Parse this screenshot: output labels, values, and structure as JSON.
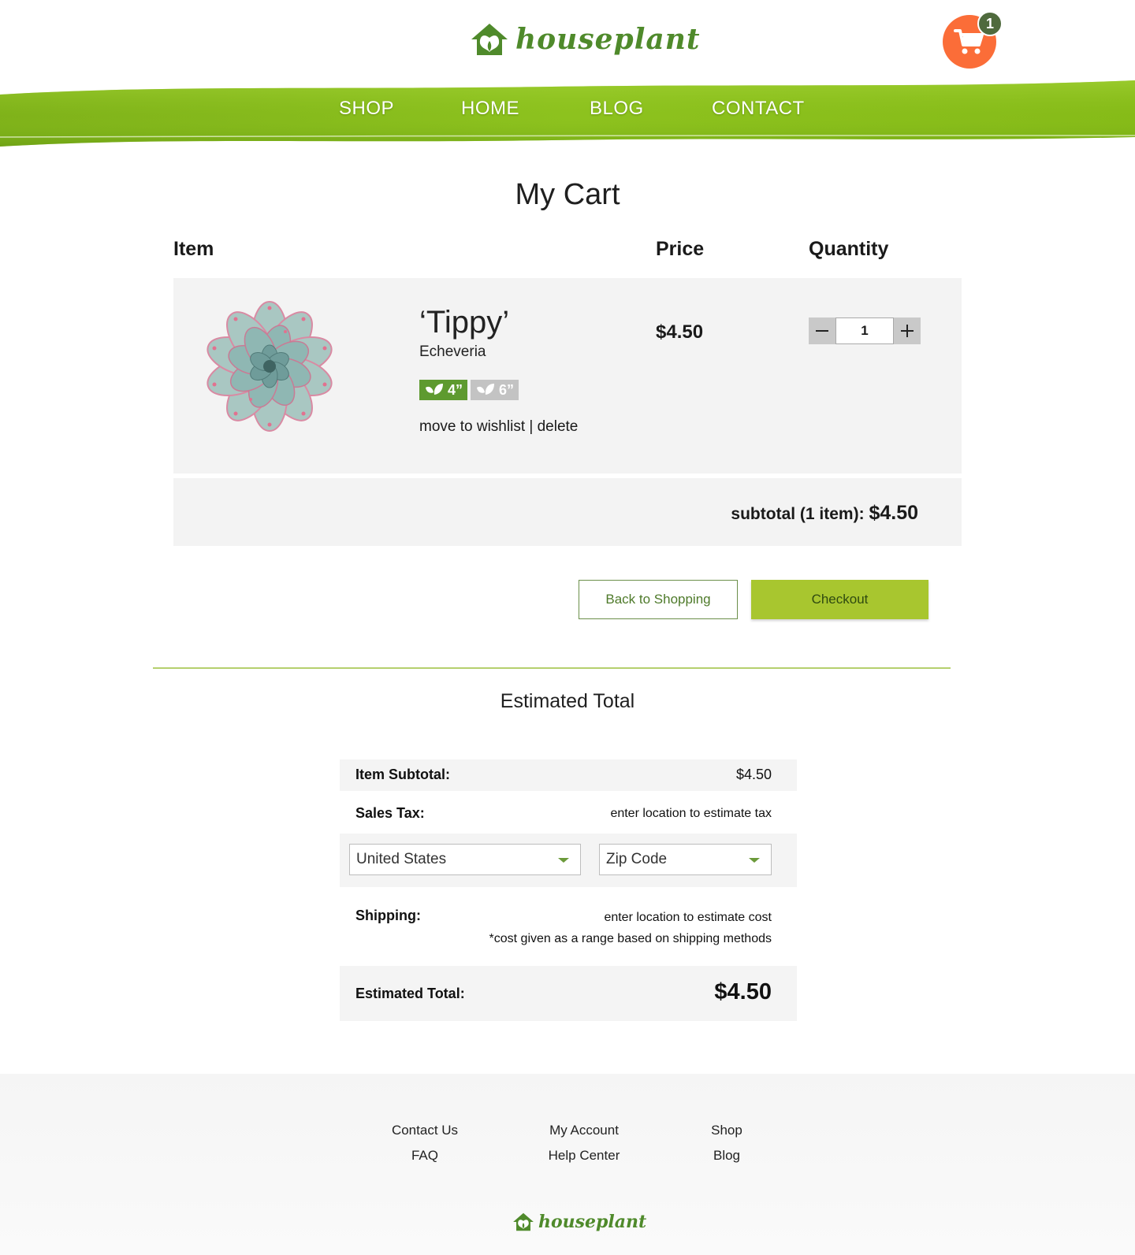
{
  "brand": {
    "name": "houseplant",
    "primary_color": "#4f8a2b",
    "accent_color": "#fb6d38",
    "nav_green": "#8fc31f"
  },
  "cart_icon": {
    "icon": "shopping-cart-icon",
    "count": "1"
  },
  "nav": {
    "items": [
      "SHOP",
      "HOME",
      "BLOG",
      "CONTACT"
    ]
  },
  "cart": {
    "title": "My Cart",
    "columns": {
      "item": "Item",
      "price": "Price",
      "quantity": "Quantity"
    },
    "items": [
      {
        "name": "‘Tippy’",
        "type": "Echeveria",
        "image": "succulent-echeveria",
        "sizes": [
          {
            "label": "4”",
            "selected": true
          },
          {
            "label": "6”",
            "selected": false
          }
        ],
        "actions": {
          "wishlist": "move to wishlist",
          "separator": "|",
          "delete": "delete"
        },
        "price": "$4.50",
        "quantity": "1"
      }
    ],
    "subtotal_label": "subtotal (1 item):",
    "subtotal_value": "$4.50",
    "back_button": "Back to Shopping",
    "checkout_button": "Checkout"
  },
  "estimate": {
    "title": "Estimated Total",
    "item_subtotal_label": "Item Subtotal:",
    "item_subtotal_value": "$4.50",
    "sales_tax_label": "Sales Tax:",
    "sales_tax_note": "enter location to estimate tax",
    "country_select": "United States",
    "zip_select": "Zip Code",
    "shipping_label": "Shipping:",
    "shipping_note": "enter location to estimate cost",
    "shipping_subnote": "*cost given as a range based on shipping methods",
    "total_label": "Estimated Total:",
    "total_value": "$4.50"
  },
  "footer": {
    "col1": [
      "Contact Us",
      "FAQ"
    ],
    "col2": [
      "My Account",
      "Help Center"
    ],
    "col3": [
      "Shop",
      "Blog"
    ],
    "logo": "houseplant"
  }
}
